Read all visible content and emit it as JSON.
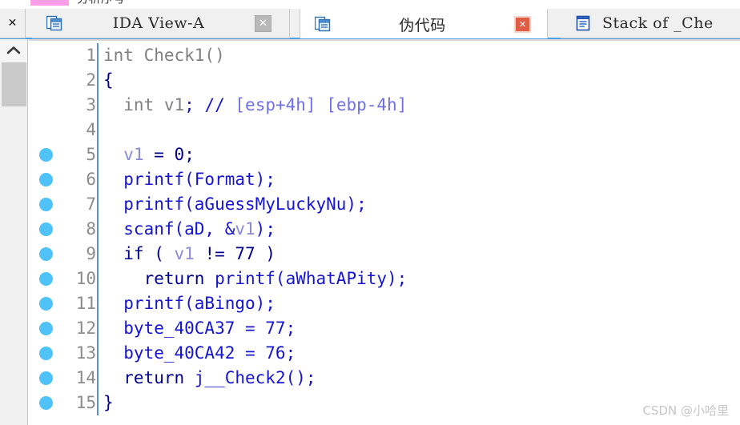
{
  "top_strip": {
    "swatch_color": "#ff9ee8",
    "clipped_text": "分析序号"
  },
  "tabbar": {
    "accent_color": "#4ca3e8",
    "close_all_label": "✕",
    "tabs": [
      {
        "id": "ida",
        "label": "IDA View-A",
        "icon": "window-copy-icon",
        "close_label": "✕",
        "close_style": "gray",
        "active": false
      },
      {
        "id": "pseudo",
        "label": "伪代码",
        "icon": "window-copy-icon",
        "close_label": "✕",
        "close_style": "red",
        "active": true
      },
      {
        "id": "stack",
        "label": "Stack of _Che",
        "icon": "document-lines-icon",
        "close_label": "",
        "close_style": "none",
        "active": false
      }
    ]
  },
  "scrollbar": {
    "up_arrow": "chevron-up-icon"
  },
  "code": {
    "breakpoint_color": "#4fc3f7",
    "lines": [
      {
        "number": "1",
        "breakpoint": false,
        "tokens": [
          {
            "t": "int Check1()",
            "c": "tk-gray"
          }
        ]
      },
      {
        "number": "2",
        "breakpoint": false,
        "tokens": [
          {
            "t": "{",
            "c": "tk-navy"
          }
        ]
      },
      {
        "number": "3",
        "breakpoint": false,
        "tokens": [
          {
            "t": "  int v1",
            "c": "tk-gray"
          },
          {
            "t": ";",
            "c": "tk-blue"
          },
          {
            "t": " ",
            "c": "tk-gray"
          },
          {
            "t": "//",
            "c": "tk-blue"
          },
          {
            "t": " [esp+4h] [ebp-4h]",
            "c": "tk-lav"
          }
        ]
      },
      {
        "number": "4",
        "breakpoint": false,
        "tokens": [
          {
            "t": "",
            "c": "tk-gray"
          }
        ]
      },
      {
        "number": "5",
        "breakpoint": true,
        "tokens": [
          {
            "t": "  ",
            "c": "tk-gray"
          },
          {
            "t": "v1",
            "c": "tk-var"
          },
          {
            "t": " = ",
            "c": "tk-navy"
          },
          {
            "t": "0",
            "c": "tk-navy"
          },
          {
            "t": ";",
            "c": "tk-navy"
          }
        ]
      },
      {
        "number": "6",
        "breakpoint": true,
        "tokens": [
          {
            "t": "  printf(Format);",
            "c": "tk-blue"
          }
        ]
      },
      {
        "number": "7",
        "breakpoint": true,
        "tokens": [
          {
            "t": "  printf(aGuessMyLuckyNu);",
            "c": "tk-blue"
          }
        ]
      },
      {
        "number": "8",
        "breakpoint": true,
        "tokens": [
          {
            "t": "  scanf(aD, &",
            "c": "tk-blue"
          },
          {
            "t": "v1",
            "c": "tk-var"
          },
          {
            "t": ");",
            "c": "tk-blue"
          }
        ]
      },
      {
        "number": "9",
        "breakpoint": true,
        "tokens": [
          {
            "t": "  if ( ",
            "c": "tk-navy"
          },
          {
            "t": "v1",
            "c": "tk-var"
          },
          {
            "t": " != ",
            "c": "tk-navy"
          },
          {
            "t": "77",
            "c": "tk-navy"
          },
          {
            "t": " )",
            "c": "tk-navy"
          }
        ]
      },
      {
        "number": "10",
        "breakpoint": true,
        "tokens": [
          {
            "t": "    return ",
            "c": "tk-navy"
          },
          {
            "t": "printf(aWhatAPity);",
            "c": "tk-blue"
          }
        ]
      },
      {
        "number": "11",
        "breakpoint": true,
        "tokens": [
          {
            "t": "  printf(aBingo);",
            "c": "tk-blue"
          }
        ]
      },
      {
        "number": "12",
        "breakpoint": true,
        "tokens": [
          {
            "t": "  byte_40CA37 = 77;",
            "c": "tk-blue"
          }
        ]
      },
      {
        "number": "13",
        "breakpoint": true,
        "tokens": [
          {
            "t": "  byte_40CA42 = 76;",
            "c": "tk-blue"
          }
        ]
      },
      {
        "number": "14",
        "breakpoint": true,
        "tokens": [
          {
            "t": "  return ",
            "c": "tk-navy"
          },
          {
            "t": "j__Check2();",
            "c": "tk-blue"
          }
        ]
      },
      {
        "number": "15",
        "breakpoint": true,
        "tokens": [
          {
            "t": "}",
            "c": "tk-navy"
          }
        ]
      }
    ]
  },
  "watermark": {
    "text": "CSDN @小哈里"
  }
}
